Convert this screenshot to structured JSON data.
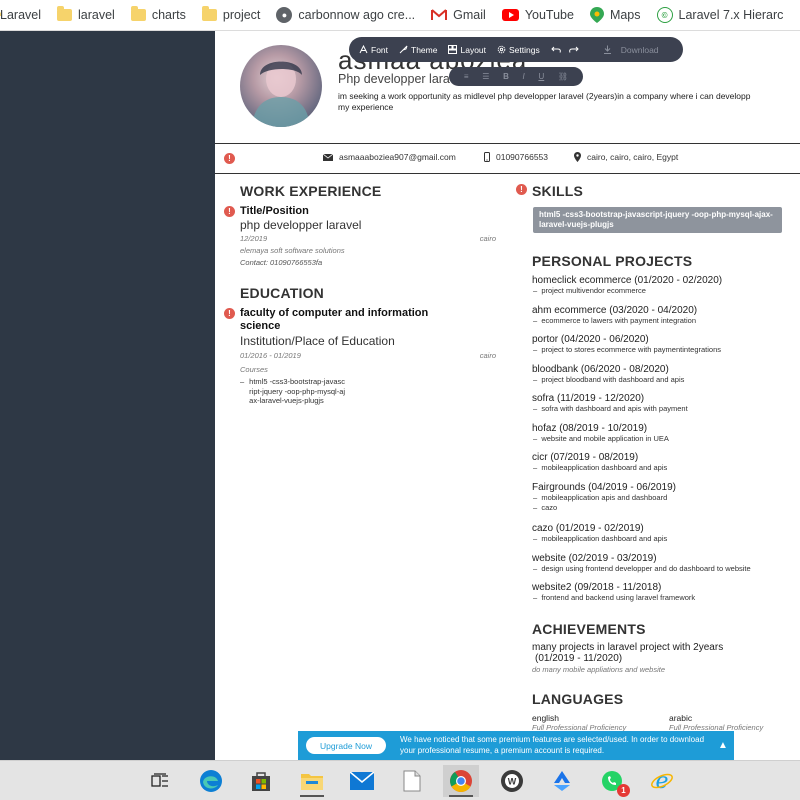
{
  "bookmarks": [
    {
      "label": "Laravel",
      "icon": "folder-icon"
    },
    {
      "label": "laravel",
      "icon": "folder-icon"
    },
    {
      "label": "charts",
      "icon": "folder-icon"
    },
    {
      "label": "project",
      "icon": "folder-icon"
    },
    {
      "label": "carbonnow ago cre...",
      "icon": "globe-icon"
    },
    {
      "label": "Gmail",
      "icon": "gmail-icon"
    },
    {
      "label": "YouTube",
      "icon": "youtube-icon"
    },
    {
      "label": "Maps",
      "icon": "maps-icon"
    },
    {
      "label": "Laravel 7.x Hierarc",
      "icon": "laravel-icon"
    }
  ],
  "toolbar": {
    "font": "Font",
    "theme": "Theme",
    "layout": "Layout",
    "settings": "Settings",
    "download": "Download"
  },
  "format": {
    "bold": "B",
    "italic": "I",
    "underline": "U"
  },
  "profile": {
    "name": "asmaa aboziea",
    "headline": "Php developper laravel",
    "summary": "im seeking a work opportunity as midlevel php developper laravel (2years)in a company where i can developp my experience"
  },
  "contact": {
    "email": "asmaaaboziea907@gmail.com",
    "phone": "01090766553",
    "location": "cairo, cairo, cairo, Egypt"
  },
  "work": {
    "heading": "WORK EXPERIENCE",
    "title": "Title/Position",
    "role": "php developper laravel",
    "date": "12/2019",
    "place": "cairo",
    "company": "elemaya soft software solutions",
    "contact": "Contact: 01090766553fa"
  },
  "education": {
    "heading": "EDUCATION",
    "school": "faculty of computer and information science",
    "institution": "Institution/Place of Education",
    "date": "01/2016 - 01/2019",
    "place": "cairo",
    "courses_label": "Courses",
    "course": "html5 -css3-bootstrap-javascript-jquery -oop-php-mysql-ajax-laravel-vuejs-plugjs"
  },
  "skills": {
    "heading": "SKILLS",
    "value": "html5 -css3-bootstrap-javascript-jquery -oop-php-mysql-ajax-laravel-vuejs-plugjs"
  },
  "projects": {
    "heading": "PERSONAL PROJECTS",
    "items": [
      {
        "title": "homeclick ecommerce (01/2020 - 02/2020)",
        "desc": [
          "project multivendor ecommerce"
        ]
      },
      {
        "title": "ahm ecommerce (03/2020 - 04/2020)",
        "desc": [
          "ecommerce to lawers with payment integration"
        ]
      },
      {
        "title": "portor (04/2020 - 06/2020)",
        "desc": [
          "project to stores ecommerce with paymentintegrations"
        ]
      },
      {
        "title": "bloodbank (06/2020 - 08/2020)",
        "desc": [
          "project bloodband with dashboard and apis"
        ]
      },
      {
        "title": "sofra (11/2019 - 12/2020)",
        "desc": [
          "sofra with dashboard and apis with payment"
        ]
      },
      {
        "title": "hofaz (08/2019 - 10/2019)",
        "desc": [
          "website and mobile application in UEA"
        ]
      },
      {
        "title": "cicr (07/2019 - 08/2019)",
        "desc": [
          "mobileapplication dashboard and apis"
        ]
      },
      {
        "title": "Fairgrounds (04/2019 - 06/2019)",
        "desc": [
          "mobileapplication apis and dashboard",
          "cazo"
        ]
      },
      {
        "title": "cazo (01/2019 - 02/2019)",
        "desc": [
          "mobileapplication dashboard and apis"
        ]
      },
      {
        "title": "website (02/2019 - 03/2019)",
        "desc": [
          "design using frontend developper and do dashboard to website"
        ]
      },
      {
        "title": "website2 (09/2018 - 11/2018)",
        "desc": [
          "frontend and backend using laravel framework"
        ]
      }
    ]
  },
  "achievements": {
    "heading": "ACHIEVEMENTS",
    "line1": "many projects in laravel project with 2years",
    "line2": "(01/2019 - 11/2020)",
    "line3": "do many mobile appliations and website"
  },
  "languages": {
    "heading": "LANGUAGES",
    "items": [
      {
        "name": "english",
        "level": "Full Professional Proficiency"
      },
      {
        "name": "arabic",
        "level": "Full Professional Proficiency"
      }
    ]
  },
  "banner": {
    "button": "Upgrade Now",
    "text": "We have noticed that some premium features are selected/used. In order to download your professional resume, a premium account is required."
  },
  "taskbar": [
    {
      "icon": "task-view-icon"
    },
    {
      "icon": "edge-icon"
    },
    {
      "icon": "store-icon"
    },
    {
      "icon": "file-explorer-icon"
    },
    {
      "icon": "mail-icon"
    },
    {
      "icon": "document-icon"
    },
    {
      "icon": "chrome-icon"
    },
    {
      "icon": "app-w-icon"
    },
    {
      "icon": "sync-icon"
    },
    {
      "icon": "whatsapp-icon",
      "badge": "1"
    },
    {
      "icon": "internet-explorer-icon"
    }
  ],
  "colors": {
    "sidebar": "#2e3845",
    "toolbar": "#3c4150",
    "banner": "#1e9cd7",
    "warning": "#e05a4f",
    "skill_box": "#8e949d"
  }
}
